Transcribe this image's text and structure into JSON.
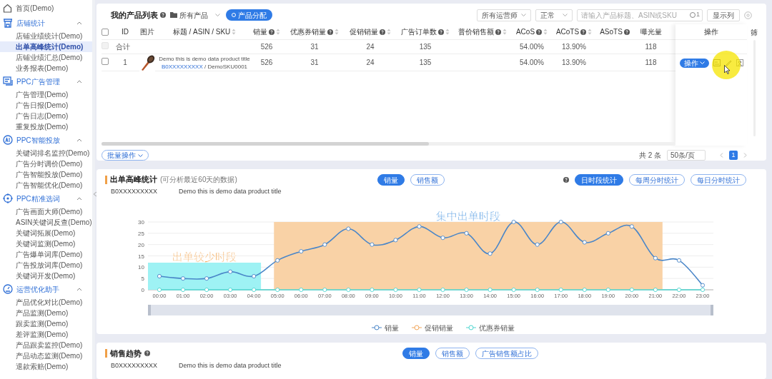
{
  "sidebar": {
    "items": [
      {
        "kind": "link",
        "label": "首页(Demo)",
        "selected": false
      },
      {
        "kind": "group",
        "label": "店铺统计",
        "expanded": true,
        "children": [
          {
            "label": "店铺业绩统计(Demo)",
            "selected": false
          },
          {
            "label": "出单高峰统计(Demo)",
            "selected": true
          },
          {
            "label": "店铺业绩汇总(Demo)",
            "selected": false
          },
          {
            "label": "业务报表(Demo)",
            "selected": false
          }
        ]
      },
      {
        "kind": "group",
        "label": "PPC广告管理",
        "expanded": true,
        "children": [
          {
            "label": "广告管理(Demo)",
            "selected": false
          },
          {
            "label": "广告日报(Demo)",
            "selected": false
          },
          {
            "label": "广告日志(Demo)",
            "selected": false
          },
          {
            "label": "重复投放(Demo)",
            "selected": false
          }
        ]
      },
      {
        "kind": "group",
        "label": "PPC智能投放",
        "expanded": true,
        "children": [
          {
            "label": "关键词排名监控(Demo)",
            "selected": false
          },
          {
            "label": "广告分时调价(Demo)",
            "selected": false
          },
          {
            "label": "广告智能投放(Demo)",
            "selected": false
          },
          {
            "label": "广告智能优化(Demo)",
            "selected": false
          }
        ]
      },
      {
        "kind": "group",
        "label": "PPC精准选词",
        "expanded": true,
        "children": [
          {
            "label": "广告画面大师(Demo)",
            "selected": false
          },
          {
            "label": "ASIN关键词反查(Demo)",
            "selected": false
          },
          {
            "label": "关键词拓展(Demo)",
            "selected": false
          },
          {
            "label": "关键词监测(Demo)",
            "selected": false
          },
          {
            "label": "广告爆单词库(Demo)",
            "selected": false
          },
          {
            "label": "广告投放词库(Demo)",
            "selected": false
          },
          {
            "label": "关键词开发(Demo)",
            "selected": false
          }
        ]
      },
      {
        "kind": "group",
        "label": "运营优化助手",
        "expanded": true,
        "children": [
          {
            "label": "产品优化对比(Demo)",
            "selected": false
          },
          {
            "label": "产品监测(Demo)",
            "selected": false
          },
          {
            "label": "跟卖监测(Demo)",
            "selected": false
          },
          {
            "label": "差评监测(Demo)",
            "selected": false
          },
          {
            "label": "产品跟卖监控(Demo)",
            "selected": false
          },
          {
            "label": "产品动态监测(Demo)",
            "selected": false
          },
          {
            "label": "退款索赔(Demo)",
            "selected": false
          }
        ]
      }
    ]
  },
  "product_list": {
    "title": "我的产品列表",
    "folder_filter": "所有产品",
    "assign_button": "产品分配",
    "operator_select": "所有运营师",
    "status_select": "正常",
    "search": {
      "placeholder": "请输入产品标题、ASIN或SKU"
    },
    "search_toggle": "1",
    "columns_button": "显示列",
    "columns": [
      {
        "kind": "checkbox",
        "checked": false
      },
      {
        "kind": "text",
        "label": "ID"
      },
      {
        "kind": "text",
        "label": "图片"
      },
      {
        "kind": "text",
        "label": "标题 / ASIN / SKU",
        "sortable": true
      },
      {
        "kind": "text",
        "label": "销量",
        "help": true,
        "sortable": true
      },
      {
        "kind": "text",
        "label": "优惠券销量",
        "help": true,
        "sortable": true
      },
      {
        "kind": "text",
        "label": "促销销量",
        "help": true,
        "sortable": true
      },
      {
        "kind": "text",
        "label": "广告订单数",
        "help": true,
        "sortable": true
      },
      {
        "kind": "text",
        "label": "普价销售额",
        "help": true,
        "sortable": true
      },
      {
        "kind": "text",
        "label": "ACoS",
        "help": true,
        "sortable": true
      },
      {
        "kind": "text",
        "label": "ACoTS",
        "help": true,
        "sortable": true
      },
      {
        "kind": "text",
        "label": "ASoTS",
        "help": true
      },
      {
        "kind": "text",
        "label": "曝光量"
      }
    ],
    "actions_column": "操作",
    "last_column": "筛",
    "total_row": {
      "label": "合计",
      "checkbox_disabled": true,
      "metrics": {
        "sales": "526",
        "coupon_sales": "31",
        "promo_sales": "24",
        "ad_orders": "135",
        "acos": "54.00%",
        "acots": "13.90%",
        "impressions": "118"
      }
    },
    "rows": [
      {
        "checked": false,
        "id": "1",
        "title": "Demo this is demo data product title",
        "asin": "B0XXXXXXXXX",
        "sku": "/ DemoSKU0001",
        "metrics": {
          "sales": "526",
          "coupon_sales": "31",
          "promo_sales": "24",
          "ad_orders": "135",
          "acos": "54.00%",
          "acots": "13.90%",
          "impressions": "118"
        },
        "action_button": "操作"
      }
    ],
    "batch_button": "批量操作",
    "total": "共 2 条",
    "page_size": "50条/页",
    "pages": [
      {
        "label": "1",
        "selected": true
      }
    ]
  },
  "peak_stats": {
    "title": "出单高峰统计",
    "note": "(可分析最近60天的数据)",
    "metric_tabs": [
      {
        "label": "销量",
        "selected": true
      },
      {
        "label": "销售额",
        "selected": false
      }
    ],
    "view_tabs": [
      {
        "label": "日时段统计",
        "selected": true
      },
      {
        "label": "每周分时统计",
        "selected": false
      },
      {
        "label": "每日分时统计",
        "selected": false
      }
    ],
    "asin": "B0XXXXXXXXX",
    "product_title": "Demo this is demo data product title",
    "chart_data": {
      "type": "line",
      "categories": [
        "00:00",
        "01:00",
        "02:00",
        "03:00",
        "04:00",
        "05:00",
        "06:00",
        "07:00",
        "08:00",
        "09:00",
        "10:00",
        "11:00",
        "12:00",
        "13:00",
        "14:00",
        "15:00",
        "16:00",
        "17:00",
        "18:00",
        "19:00",
        "20:00",
        "21:00",
        "22:00",
        "23:00"
      ],
      "series": [
        {
          "name": "销量",
          "color": "#4a86c8",
          "marker": "circle",
          "values": [
            6,
            5,
            5,
            8,
            6,
            13,
            17,
            20,
            27,
            20,
            22,
            28,
            23,
            25,
            16,
            30,
            20,
            30,
            21,
            25,
            28,
            14,
            13,
            2
          ]
        },
        {
          "name": "促销销量",
          "color": "#f2a65a",
          "marker": "circle",
          "values": [
            null,
            null,
            null,
            null,
            null,
            null,
            null,
            null,
            null,
            null,
            null,
            null,
            null,
            null,
            null,
            null,
            null,
            null,
            null,
            null,
            null,
            null,
            null,
            null
          ]
        },
        {
          "name": "优惠券销量",
          "color": "#4fd6d0",
          "marker": "circle",
          "values": [
            0,
            0,
            0,
            0,
            0,
            0,
            0,
            0,
            0,
            0,
            0,
            0,
            0,
            0,
            0,
            0,
            0,
            0,
            0,
            0,
            0,
            0,
            0,
            0
          ]
        }
      ],
      "ylim": [
        0,
        30
      ],
      "yticks": [
        0,
        5,
        10,
        15,
        20,
        25,
        30
      ],
      "grid": true,
      "legend": "bottom",
      "bands": [
        {
          "axis": "x",
          "from": "00:00",
          "to": "04:00",
          "color": "#9ef2f4",
          "label": "出单较少时段"
        },
        {
          "axis": "x",
          "from": "05:00",
          "to": "21:00",
          "color": "#f9d2a6",
          "label": "集中出单时段"
        }
      ]
    }
  },
  "sales_trend": {
    "title": "销售趋势",
    "help": true,
    "tabs": [
      {
        "label": "销量",
        "selected": true
      },
      {
        "label": "销售额",
        "selected": false
      },
      {
        "label": "广告销售额占比",
        "selected": false
      }
    ],
    "asin": "B0XXXXXXXXX",
    "product_title": "Demo this is demo data product title"
  }
}
